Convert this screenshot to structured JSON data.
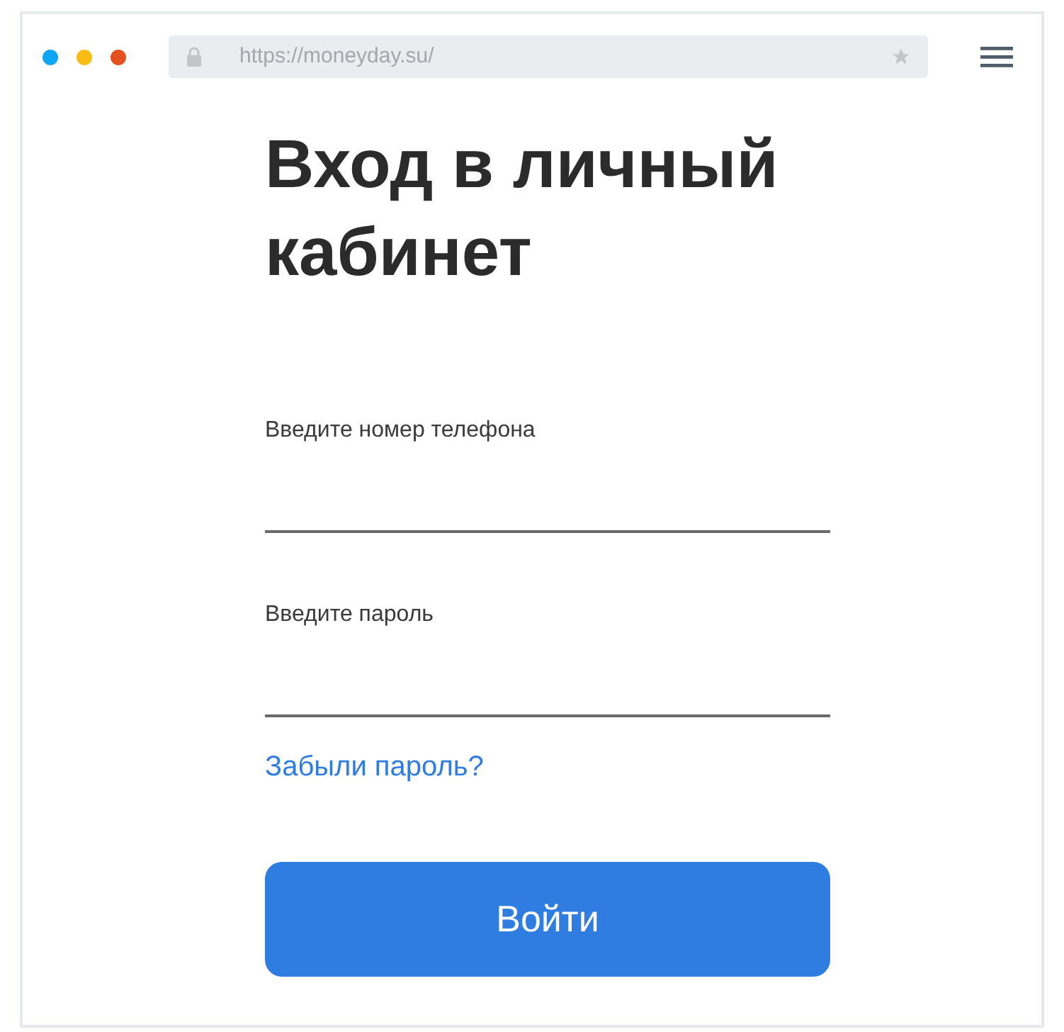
{
  "browser": {
    "dots": [
      {
        "color": "#0ea5f5"
      },
      {
        "color": "#f8bc12"
      },
      {
        "color": "#e4501e"
      }
    ],
    "url": "https://moneyday.su/"
  },
  "page": {
    "title": "Вход в личный кабинет",
    "fields": [
      {
        "label": "Введите номер телефона"
      },
      {
        "label": "Введите пароль"
      }
    ],
    "forgot_link": "Забыли пароль?",
    "submit": "Войти"
  }
}
